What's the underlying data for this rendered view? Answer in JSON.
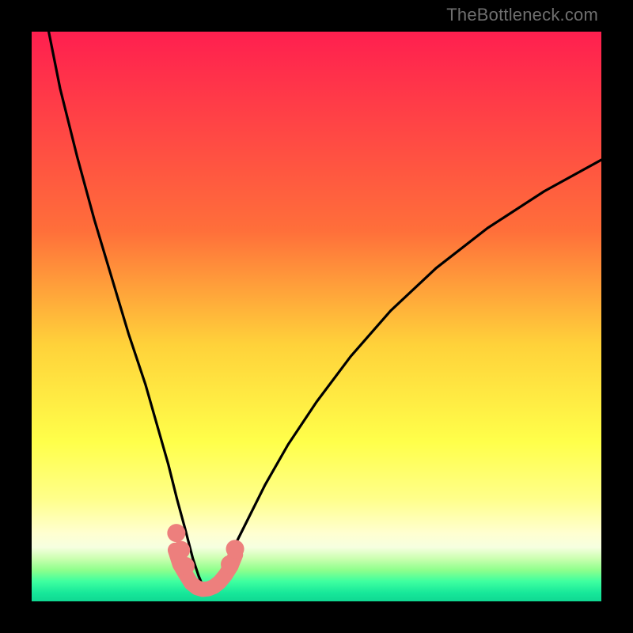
{
  "watermark": "TheBottleneck.com",
  "chart_data": {
    "type": "line",
    "title": "",
    "xlabel": "",
    "ylabel": "",
    "xlim": [
      0,
      100
    ],
    "ylim": [
      0,
      100
    ],
    "gradient_stops": [
      {
        "offset": 0,
        "color": "#ff1f4f"
      },
      {
        "offset": 0.35,
        "color": "#ff6f3a"
      },
      {
        "offset": 0.55,
        "color": "#ffd23a"
      },
      {
        "offset": 0.72,
        "color": "#ffff4a"
      },
      {
        "offset": 0.82,
        "color": "#ffff8a"
      },
      {
        "offset": 0.88,
        "color": "#ffffd0"
      },
      {
        "offset": 0.905,
        "color": "#f6ffe0"
      },
      {
        "offset": 0.925,
        "color": "#caffb0"
      },
      {
        "offset": 0.945,
        "color": "#8fff8c"
      },
      {
        "offset": 0.965,
        "color": "#3effa0"
      },
      {
        "offset": 0.985,
        "color": "#17e89a"
      },
      {
        "offset": 1.0,
        "color": "#0fd892"
      }
    ],
    "series": [
      {
        "name": "bottleneck-curve",
        "type": "line",
        "stroke": "#000000",
        "x": [
          3,
          5,
          8,
          11,
          14,
          17,
          20,
          22,
          24,
          25.5,
          27,
          28.3,
          29.3,
          30,
          30.6,
          31.2,
          32,
          33.5,
          35.5,
          38,
          41,
          45,
          50,
          56,
          63,
          71,
          80,
          90,
          100
        ],
        "y": [
          100,
          90,
          78,
          67,
          57,
          47,
          38,
          31,
          24,
          18,
          12.5,
          7.5,
          4.5,
          2.8,
          2.2,
          2.4,
          3.2,
          5.5,
          9.5,
          14.5,
          20.5,
          27.5,
          35,
          43,
          51,
          58.5,
          65.5,
          72,
          77.5
        ]
      },
      {
        "name": "highlight-band",
        "type": "line",
        "stroke": "#ed7f7d",
        "x": [
          25.2,
          26.0,
          27.0,
          28.0,
          29.0,
          30.0,
          31.0,
          32.0,
          33.0,
          34.0,
          35.0,
          35.8
        ],
        "y": [
          9.0,
          6.5,
          4.8,
          3.2,
          2.4,
          2.1,
          2.2,
          2.6,
          3.4,
          4.6,
          6.2,
          8.2
        ]
      }
    ],
    "markers": [
      {
        "x": 25.4,
        "y": 12.0,
        "r": 1.6,
        "color": "#ed7f7d"
      },
      {
        "x": 26.2,
        "y": 9.0,
        "r": 1.6,
        "color": "#ed7f7d"
      },
      {
        "x": 27.0,
        "y": 6.2,
        "r": 1.6,
        "color": "#ed7f7d"
      },
      {
        "x": 34.8,
        "y": 6.5,
        "r": 1.6,
        "color": "#ed7f7d"
      },
      {
        "x": 35.7,
        "y": 9.2,
        "r": 1.6,
        "color": "#ed7f7d"
      }
    ]
  }
}
